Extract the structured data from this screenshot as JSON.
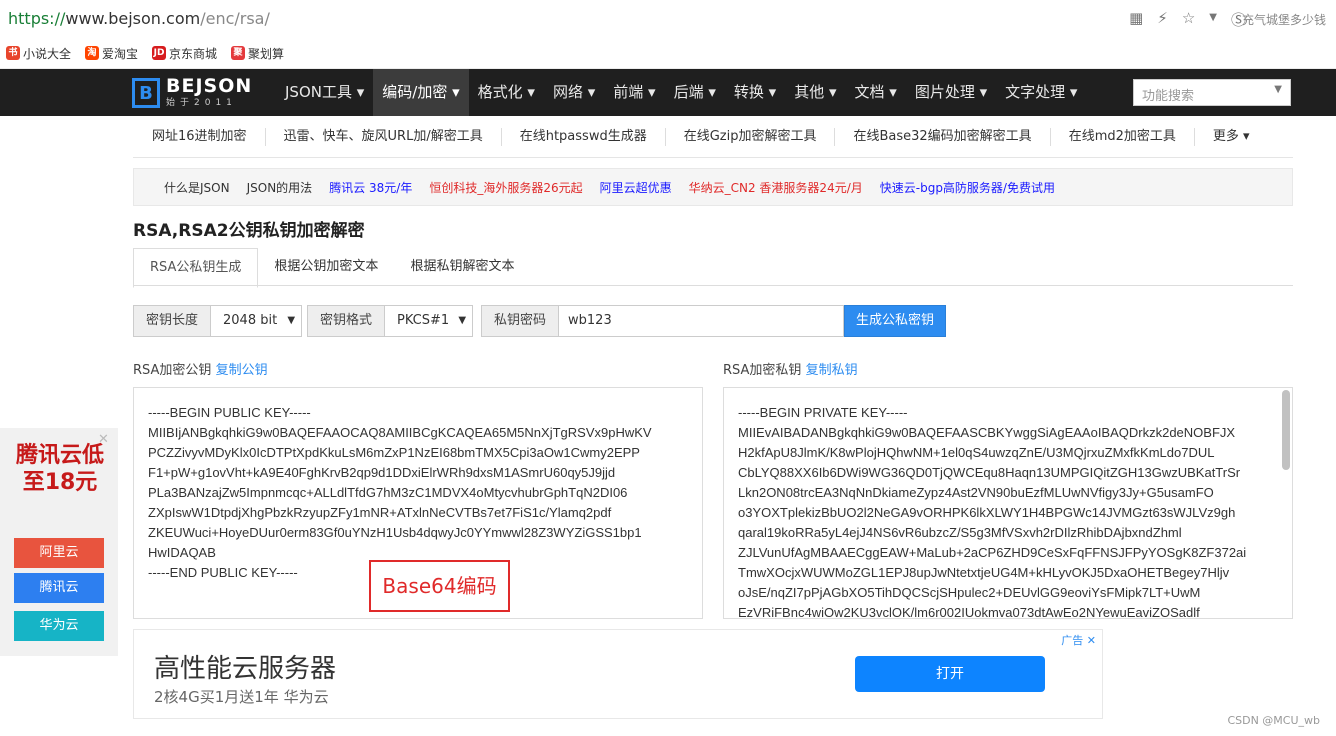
{
  "browser": {
    "url_scheme": "https://",
    "url_host": "www.bejson.com",
    "url_path": "/enc/rsa/",
    "user_text": "充气城堡多少钱",
    "bookmarks": [
      {
        "label": "小说大全",
        "color": "#e8452c",
        "glyph": "书"
      },
      {
        "label": "爱淘宝",
        "color": "#ff4400",
        "glyph": "淘"
      },
      {
        "label": "京东商城",
        "color": "#d71c1e",
        "glyph": "JD"
      },
      {
        "label": "聚划算",
        "color": "#e4393c",
        "glyph": "聚"
      }
    ]
  },
  "site": {
    "logo_letter": "B",
    "logo_name": "BEJSON",
    "logo_sub": "始于2011",
    "menu": [
      "JSON工具 ▾",
      "编码/加密 ▾",
      "格式化 ▾",
      "网络 ▾",
      "前端 ▾",
      "后端 ▾",
      "转换 ▾",
      "其他 ▾",
      "文档 ▾",
      "图片处理 ▾",
      "文字处理 ▾"
    ],
    "active_menu_index": 1,
    "search_placeholder": "功能搜索"
  },
  "subnav": [
    "网址16进制加密",
    "迅雷、快车、旋风URL加/解密工具",
    "在线htpasswd生成器",
    "在线Gzip加密解密工具",
    "在线Base32编码加密解密工具",
    "在线md2加密工具",
    "更多 ▾"
  ],
  "ads": [
    {
      "label": "什么是JSON",
      "color": "#333333"
    },
    {
      "label": "JSON的用法",
      "color": "#333333"
    },
    {
      "label": "腾讯云 38元/年",
      "color": "#1a1aff"
    },
    {
      "label": "恒创科技_海外服务器26元起",
      "color": "#e02a2a"
    },
    {
      "label": "阿里云超优惠",
      "color": "#1a1aff"
    },
    {
      "label": "华纳云_CN2 香港服务器24元/月",
      "color": "#e02a2a"
    },
    {
      "label": "快速云-bgp高防服务器/免费试用",
      "color": "#1a1aff"
    }
  ],
  "page_title": "RSA,RSA2公钥私钥加密解密",
  "tabs": [
    "RSA公私钥生成",
    "根据公钥加密文本",
    "根据私钥解密文本"
  ],
  "form": {
    "key_length_label": "密钥长度",
    "key_length_value": "2048 bit",
    "key_format_label": "密钥格式",
    "key_format_value": "PKCS#1",
    "password_label": "私钥密码",
    "password_value": "wb123",
    "generate_button": "生成公私密钥"
  },
  "public_key": {
    "label": "RSA加密公钥",
    "copy": "复制公钥",
    "lines": [
      "-----BEGIN PUBLIC KEY-----",
      "MIIBIjANBgkqhkiG9w0BAQEFAAOCAQ8AMIIBCgKCAQEA65M5NnXjTgRSVx9pHwKV",
      "PCZZivyvMDyKlx0IcDTPtXpdKkuLsM6mZxP1NzEI68bmTMX5Cpi3aOw1Cwmy2EPP",
      "F1+pW+g1ovVht+kA9E40FghKrvB2qp9d1DDxiElrWRh9dxsM1ASmrU60qy5J9jjd",
      "PLa3BANzajZw5Impnmcqc+ALLdlTfdG7hM3zC1MDVX4oMtycvhubrGphTqN2DI06",
      "ZXpIswW1DtpdjXhgPbzkRzyupZFy1mNR+ATxlnNeCVTBs7et7FiS1c/Ylamq2pdf",
      "ZKEUWuci+HoyeDUur0erm83Gf0uYNzH1Usb4dqwyJc0YYmwwl28Z3WYZiGSS1bp1",
      "HwIDAQAB",
      "-----END PUBLIC KEY-----"
    ]
  },
  "private_key": {
    "label": "RSA加密私钥",
    "copy": "复制私钥",
    "lines": [
      "-----BEGIN PRIVATE KEY-----",
      "MIIEvAIBADANBgkqhkiG9w0BAQEFAASCBKYwggSiAgEAAoIBAQDrkzk2deNOBFJX",
      "H2kfApU8JlmK/K8wPlojHQhwNM+1el0qS4uwzqZnE/U3MQjrxuZMxfkKmLdo7DUL",
      "CbLYQ88XX6Ib6DWi9WG36QD0TjQWCEqu8Haqn13UMPGIQitZGH13GwzUBKatTrSr",
      "Lkn2ON08trcEA3NqNnDkiameZypz4Ast2VN90buEzfMLUwNVfigy3Jy+G5usamFO",
      "o3YOXTplekizBbUO2l2NeGA9vORHPK6lkXLWY1H4BPGWc14JVMGzt63sWJLVz9gh",
      "qaral19koRRa5yL4ejJ4NS6vR6ubzcZ/S5g3MfVSxvh2rDIlzRhibDAjbxndZhml",
      "ZJLVunUfAgMBAAECggEAW+MaLub+2aCP6ZHD9CeSxFqFFNSJFPyYOSgK8ZF372ai",
      "TmwXOcjxWUWMoZGL1EPJ8upJwNtetxtjeUG4M+kHLyvOKJ5DxaOHETBegey7Hljv",
      "oJsE/nqZI7pPjAGbXO5TihDQCScjSHpulec2+DEUvlGG9eoviYsFMipk7LT+UwM",
      "EzVRiFBnc4wiOw2KU3vclOK/lm6r002IUokmva073dtAwEo2NYewuEaviZOSadlf"
    ]
  },
  "annotation": "Base64编码",
  "bottom_ad": {
    "title": "高性能云服务器",
    "subtitle": "2核4G买1月送1年 华为云",
    "button": "打开",
    "tag": "广告 ✕"
  },
  "float_ad": {
    "title": "腾讯云低至18元",
    "close": "✕",
    "buttons": [
      {
        "label": "阿里云",
        "color": "#e8543e"
      },
      {
        "label": "腾讯云",
        "color": "#2d7ff0"
      },
      {
        "label": "华为云",
        "color": "#16b4c6"
      }
    ]
  },
  "watermark": "CSDN @MCU_wb"
}
